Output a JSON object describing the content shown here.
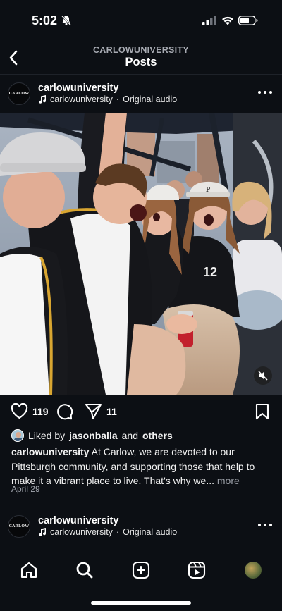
{
  "status": {
    "time": "5:02"
  },
  "header": {
    "account": "CARLOWUNIVERSITY",
    "title": "Posts"
  },
  "post": {
    "avatar_text": "CARLOW",
    "username": "carlowuniversity",
    "audio_owner": "carlowuniversity",
    "audio_sep": "·",
    "audio_label": "Original audio",
    "likes": "119",
    "shares": "11",
    "liked_prefix": "Liked by",
    "liked_user": "jasonballa",
    "liked_and": "and",
    "liked_others": "others",
    "caption_user": "carlowuniversity",
    "caption_text": "At Carlow, we are devoted to our Pittsburgh community, and supporting those that help to make it a vibrant place to live. That's why we...",
    "caption_more": "more",
    "date": "April 29",
    "jersey_number": "12"
  },
  "next_post": {
    "avatar_text": "CARLOW",
    "username": "carlowuniversity",
    "audio_owner": "carlowuniversity",
    "audio_sep": "·",
    "audio_label": "Original audio"
  },
  "icons": {
    "status": [
      "bell-off-icon",
      "signal-icon",
      "wifi-icon",
      "battery-icon"
    ],
    "actions": [
      "heart-icon",
      "comment-icon",
      "share-icon",
      "bookmark-icon"
    ],
    "nav": [
      "home-icon",
      "search-icon",
      "create-icon",
      "reels-icon",
      "profile-avatar"
    ]
  },
  "colors": {
    "background": "#0c0f14",
    "text": "#ffffff",
    "muted": "#a4a8b0"
  }
}
